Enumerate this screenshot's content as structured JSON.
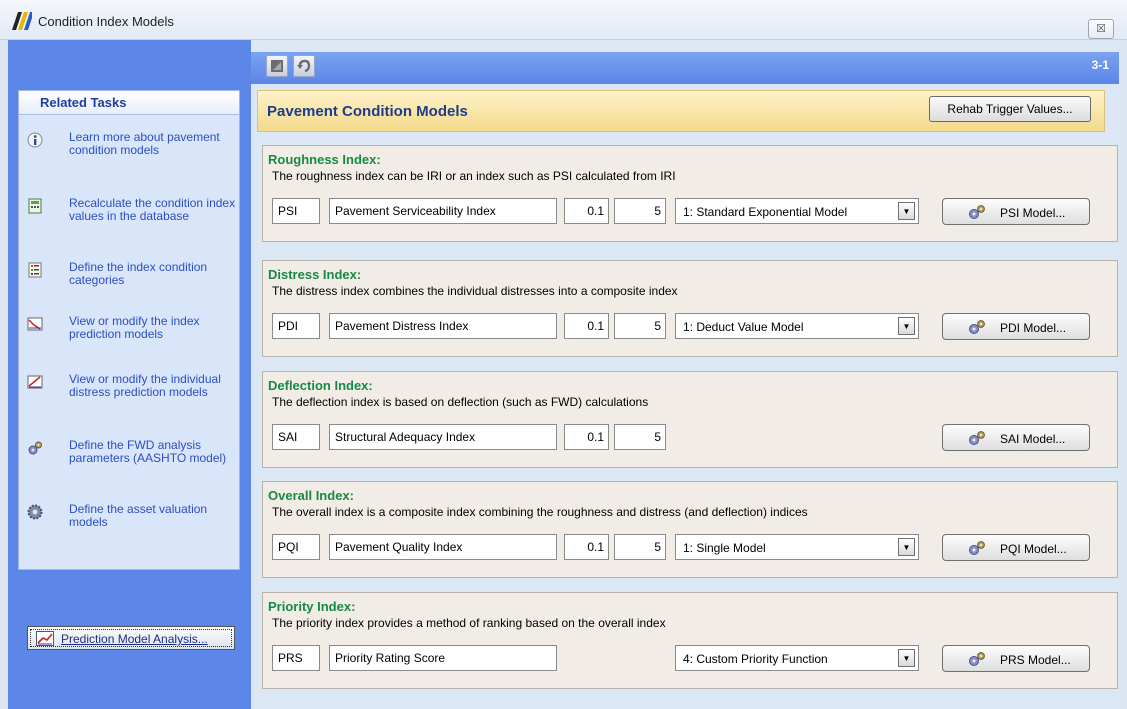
{
  "window": {
    "title": "Condition Index Models",
    "close_glyph": "☒"
  },
  "toolbar": {
    "page_number": "3-1"
  },
  "sidebar": {
    "heading": "Related Tasks",
    "tasks": [
      {
        "label": "Learn more about pavement condition models",
        "icon": "info-icon"
      },
      {
        "label": "Recalculate the condition index values in the database",
        "icon": "calculator-icon"
      },
      {
        "label": "Define the index condition categories",
        "icon": "list-icon"
      },
      {
        "label": "View or modify the index prediction models",
        "icon": "chart-icon"
      },
      {
        "label": "View or modify the individual distress prediction models",
        "icon": "trend-icon"
      },
      {
        "label": "Define the FWD analysis parameters (AASHTO model)",
        "icon": "gears-icon"
      },
      {
        "label": "Define the asset valuation models",
        "icon": "cog-icon"
      }
    ],
    "analysis_button": "Prediction Model Analysis..."
  },
  "main": {
    "title": "Pavement Condition Models",
    "rehab_button": "Rehab Trigger Values...",
    "groups": [
      {
        "title": "Roughness Index:",
        "description": "The roughness index can be IRI or an index such as PSI calculated from IRI",
        "code": "PSI",
        "name": "Pavement Serviceability Index",
        "min": "0.1",
        "max": "5",
        "model": "1: Standard Exponential Model",
        "button": "PSI Model..."
      },
      {
        "title": "Distress Index:",
        "description": "The distress index combines the individual distresses into a composite index",
        "code": "PDI",
        "name": "Pavement Distress Index",
        "min": "0.1",
        "max": "5",
        "model": "1: Deduct Value Model",
        "button": "PDI Model..."
      },
      {
        "title": "Deflection Index:",
        "description": "The deflection index is based on deflection (such as FWD) calculations",
        "code": "SAI",
        "name": "Structural Adequacy Index",
        "min": "0.1",
        "max": "5",
        "button": "SAI Model..."
      },
      {
        "title": "Overall Index:",
        "description": "The overall index is a composite index combining the roughness and distress (and deflection) indices",
        "code": "PQI",
        "name": "Pavement Quality Index",
        "min": "0.1",
        "max": "5",
        "model": "1: Single Model",
        "button": "PQI Model..."
      },
      {
        "title": "Priority Index:",
        "description": "The priority index provides a method of ranking based on the overall index",
        "code": "PRS",
        "name": "Priority Rating Score",
        "model": "4: Custom Priority Function",
        "button": "PRS Model..."
      }
    ]
  },
  "colors": {
    "sidebar": "#5c87e8",
    "group_title": "#188a45",
    "task_link": "#2b4fc6",
    "header_title": "#1e3c88"
  }
}
